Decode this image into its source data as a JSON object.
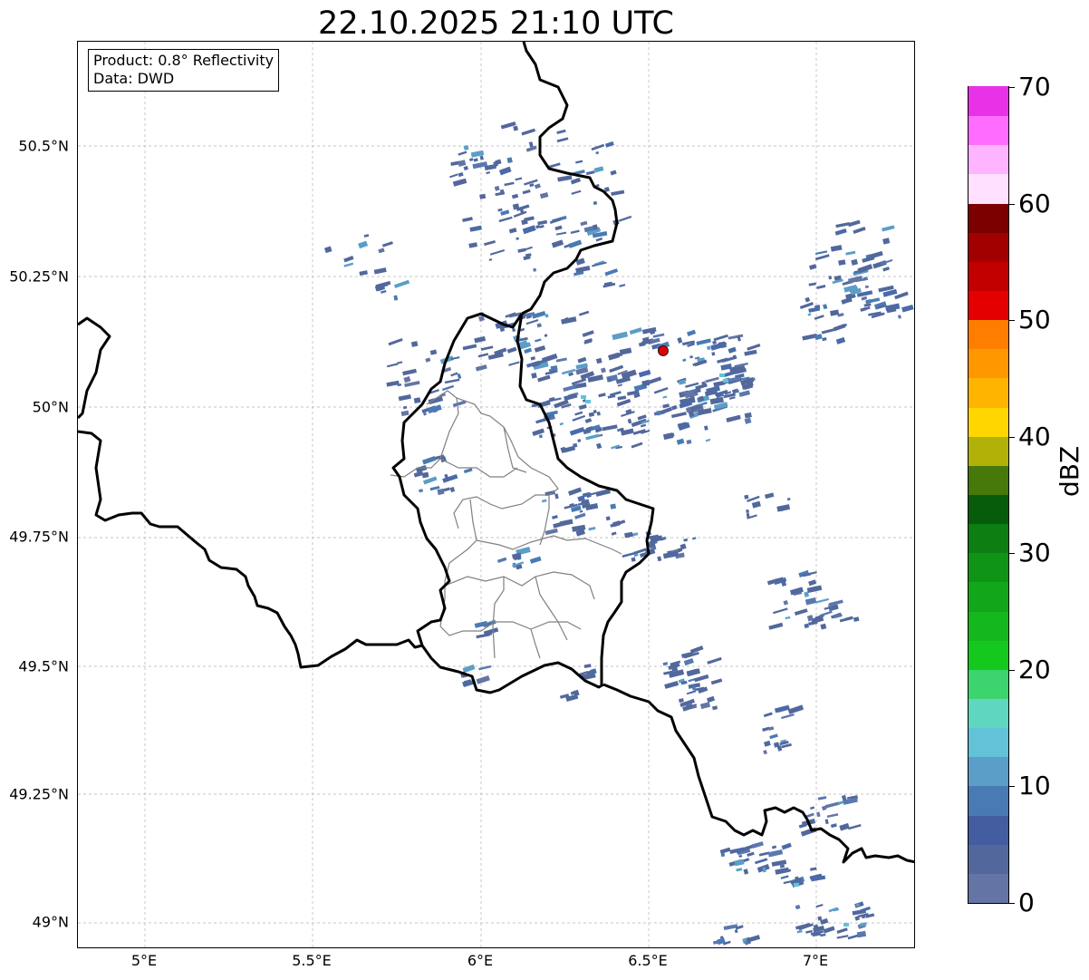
{
  "title": "22.10.2025 21:10 UTC",
  "info": {
    "product": "Product: 0.8° Reflectivity",
    "source": "Data: DWD"
  },
  "x_ticks": [
    "5°E",
    "5.5°E",
    "6°E",
    "6.5°E",
    "7°E"
  ],
  "y_ticks": [
    "50.5°N",
    "50.25°N",
    "50°N",
    "49.75°N",
    "49.5°N",
    "49.25°N",
    "49°N"
  ],
  "colorbar": {
    "unit": "dBZ",
    "labels": [
      "0",
      "10",
      "20",
      "30",
      "40",
      "50",
      "60",
      "70"
    ],
    "colors": [
      "#6474a4",
      "#52689c",
      "#445ca0",
      "#4a7ab4",
      "#5b9ec7",
      "#62c2d8",
      "#5ed6c0",
      "#3cd46e",
      "#14c81e",
      "#14b81c",
      "#12a61a",
      "#109416",
      "#0c7e12",
      "#075c0c",
      "#46780a",
      "#b0b208",
      "#ffd600",
      "#ffb400",
      "#ff9800",
      "#ff7e00",
      "#e40000",
      "#c20000",
      "#a20000",
      "#7c0000",
      "#ffe0ff",
      "#ffb4ff",
      "#ff6cff",
      "#e832e8"
    ]
  },
  "radar_site_color": "#e00000",
  "echo_color": "#52689c"
}
